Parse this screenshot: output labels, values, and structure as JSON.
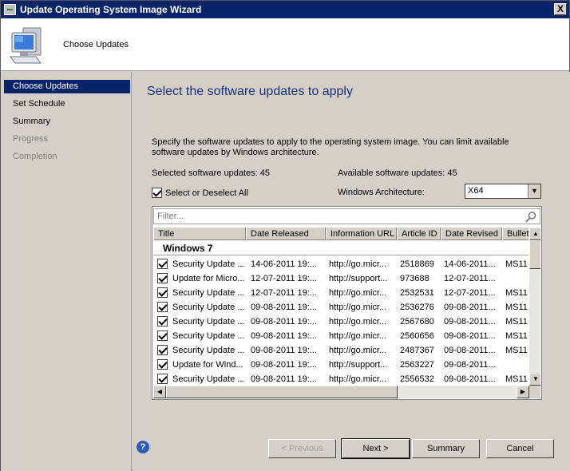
{
  "window": {
    "title": "Update Operating System Image Wizard",
    "close_label": "X"
  },
  "header": {
    "title": "Choose Updates"
  },
  "nav": {
    "items": [
      {
        "label": "Choose Updates",
        "state": "active"
      },
      {
        "label": "Set Schedule",
        "state": "normal"
      },
      {
        "label": "Summary",
        "state": "normal"
      },
      {
        "label": "Progress",
        "state": "disabled"
      },
      {
        "label": "Completion",
        "state": "disabled"
      }
    ]
  },
  "main": {
    "heading": "Select the software updates to apply",
    "description": "Specify the software updates to apply to the operating system image. You can limit available software updates by Windows architecture.",
    "selected_count": "Selected software updates: 45",
    "available_count": "Available software updates: 45",
    "select_all_label": "Select or Deselect All",
    "select_all_checked": true,
    "architecture_label": "Windows Architecture:",
    "architecture_value": "X64"
  },
  "list": {
    "filter_placeholder": "Filter...",
    "columns": [
      "Title",
      "Date Released",
      "Information URL",
      "Article ID",
      "Date Revised",
      "Bullet"
    ],
    "group": "Windows 7",
    "rows": [
      {
        "checked": true,
        "title": "Security Update ...",
        "released": "14-06-2011 19:...",
        "url": "http://go.micr...",
        "article": "2518869",
        "revised": "14-06-2011...",
        "bulletin": "MS11"
      },
      {
        "checked": true,
        "title": "Update for Micro...",
        "released": "12-07-2011 19:...",
        "url": "http://support...",
        "article": "973688",
        "revised": "12-07-2011...",
        "bulletin": ""
      },
      {
        "checked": true,
        "title": "Security Update ...",
        "released": "12-07-2011 19:...",
        "url": "http://go.micr...",
        "article": "2532531",
        "revised": "12-07-2011...",
        "bulletin": "MS11"
      },
      {
        "checked": true,
        "title": "Security Update ...",
        "released": "09-08-2011 19:...",
        "url": "http://go.micr...",
        "article": "2536276",
        "revised": "09-08-2011...",
        "bulletin": "MS11"
      },
      {
        "checked": true,
        "title": "Security Update ...",
        "released": "09-08-2011 19:...",
        "url": "http://go.micr...",
        "article": "2567680",
        "revised": "09-08-2011...",
        "bulletin": "MS11"
      },
      {
        "checked": true,
        "title": "Security Update ...",
        "released": "09-08-2011 19:...",
        "url": "http://go.micr...",
        "article": "2560656",
        "revised": "09-08-2011...",
        "bulletin": "MS11"
      },
      {
        "checked": true,
        "title": "Security Update ...",
        "released": "09-08-2011 19:...",
        "url": "http://go.micr...",
        "article": "2487367",
        "revised": "09-08-2011...",
        "bulletin": "MS11"
      },
      {
        "checked": true,
        "title": "Update for Wind...",
        "released": "09-08-2011 19:...",
        "url": "http://support...",
        "article": "2563227",
        "revised": "09-08-2011...",
        "bulletin": ""
      },
      {
        "checked": true,
        "title": "Security Update ...",
        "released": "09-08-2011 19:...",
        "url": "http://go.micr...",
        "article": "2556532",
        "revised": "09-08-2011...",
        "bulletin": "MS11"
      }
    ]
  },
  "buttons": {
    "previous": "< Previous",
    "next": "Next >",
    "summary": "Summary",
    "cancel": "Cancel"
  },
  "icons": {
    "header": "computer-monitor-icon",
    "filter": "search-icon",
    "help": "help-icon"
  },
  "colors": {
    "titlebar": "#0a246a",
    "heading": "#1b2f7a",
    "nav_active": "#0a246a"
  }
}
